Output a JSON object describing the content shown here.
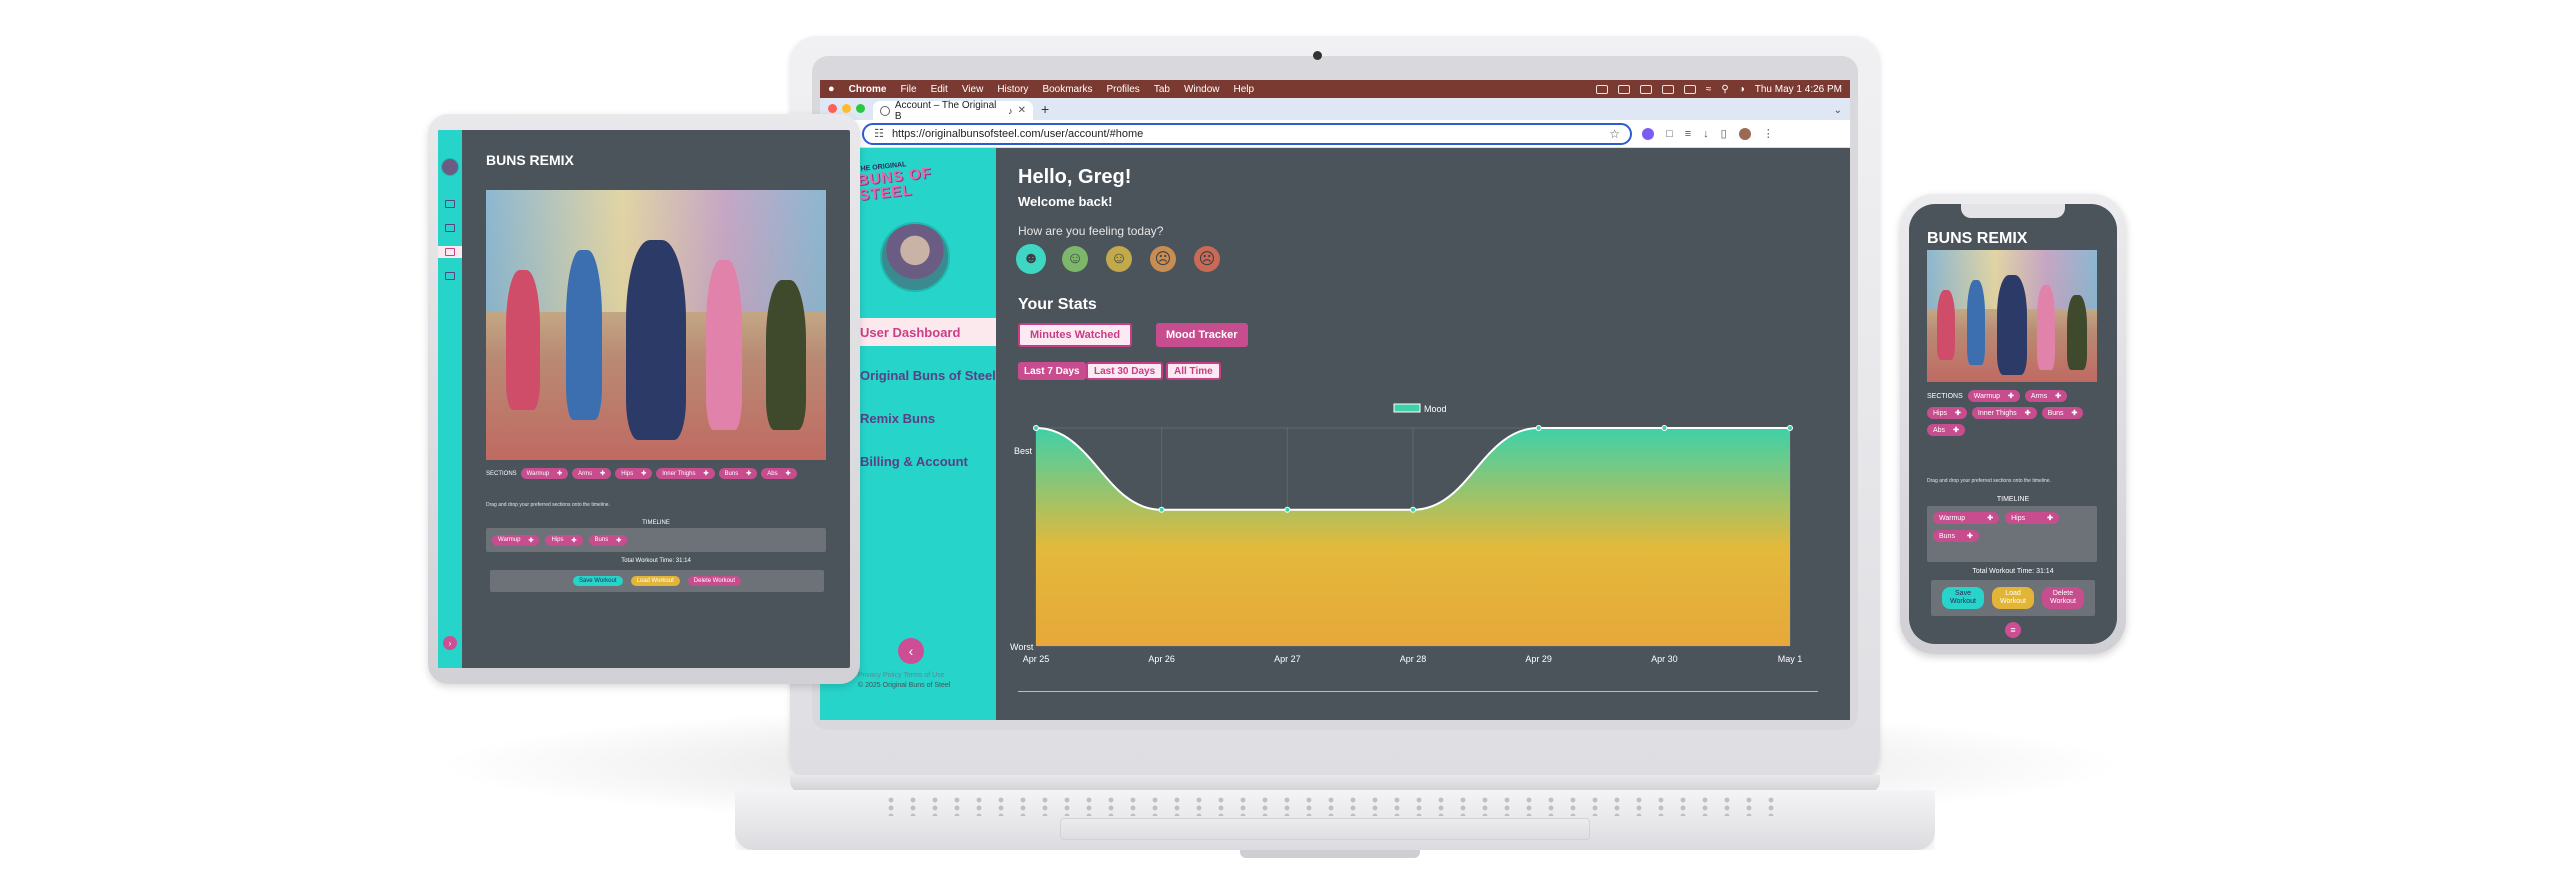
{
  "mac_menubar": {
    "app": "Chrome",
    "items": [
      "File",
      "Edit",
      "View",
      "History",
      "Bookmarks",
      "Profiles",
      "Tab",
      "Window",
      "Help"
    ],
    "clock": "Thu May 1 4:26 PM"
  },
  "browser": {
    "tab_title": "Account – The Original B",
    "url": "https://originalbunsofsteel.com/user/account/#home"
  },
  "sidebar": {
    "logo_top": "THE ORIGINAL",
    "logo_main": "BUNS OF STEEL",
    "items": [
      {
        "label": "User Dashboard",
        "active": true
      },
      {
        "label": "Original Buns of Steel",
        "active": false
      },
      {
        "label": "Remix Buns",
        "active": false
      },
      {
        "label": "Billing & Account",
        "active": false
      }
    ],
    "footer_links": "Privacy Policy    Terms of Use",
    "copyright": "© 2025 Original Buns of Steel"
  },
  "dashboard": {
    "greeting": "Hello, Greg!",
    "welcome": "Welcome back!",
    "mood_prompt": "How are you feeling today?",
    "stats_heading": "Your Stats",
    "stat_tabs": [
      "Minutes Watched",
      "Mood Tracker"
    ],
    "range_tabs": [
      "Last 7 Days",
      "Last 30 Days",
      "All Time"
    ]
  },
  "chart_data": {
    "type": "area",
    "categories": [
      "Apr 25",
      "Apr 26",
      "Apr 27",
      "Apr 28",
      "Apr 29",
      "Apr 30",
      "May 1"
    ],
    "series": [
      {
        "name": "Mood",
        "values": [
          5,
          3.5,
          3.5,
          3.5,
          5,
          5,
          5
        ]
      }
    ],
    "ylim": [
      1,
      5
    ],
    "y_tick_labels": [
      "Best",
      "Worst"
    ],
    "legend": "top-center",
    "grid": true,
    "colors": {
      "line": "#ffffff",
      "fill_top": "#3fd1a8",
      "fill_bottom": "#e6a83a"
    }
  },
  "remix_tablet": {
    "title": "BUNS REMIX",
    "sections_label": "SECTIONS",
    "sections": [
      "Warmup",
      "Arms",
      "Hips",
      "Inner Thighs",
      "Buns",
      "Abs"
    ],
    "help": "Drag and drop your preferred sections onto the timeline.",
    "timeline_label": "TIMELINE",
    "timeline": [
      "Warmup",
      "Hips",
      "Buns"
    ],
    "total": "Total Workout Time: 31:14",
    "actions": [
      "Save Workout",
      "Load Workout",
      "Delete Workout"
    ]
  },
  "remix_phone": {
    "title": "BUNS REMIX",
    "sections_label": "SECTIONS",
    "sections": [
      "Warmup",
      "Arms",
      "Hips",
      "Inner Thighs",
      "Buns",
      "Abs"
    ],
    "help": "Drag and drop your preferred sections onto the timeline.",
    "timeline_label": "TIMELINE",
    "timeline": [
      "Warmup",
      "Hips",
      "Buns"
    ],
    "total": "Total Workout Time: 31:14",
    "actions": [
      "Save Workout",
      "Load Workout",
      "Delete Workout"
    ]
  }
}
